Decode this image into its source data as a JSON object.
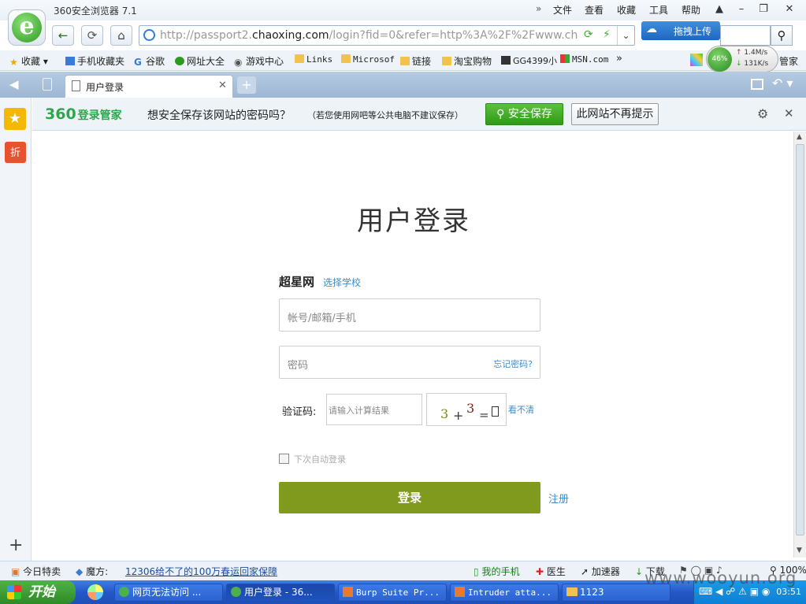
{
  "window": {
    "title": "360安全浏览器 7.1",
    "menu": [
      "文件",
      "查看",
      "收藏",
      "工具",
      "帮助"
    ]
  },
  "address": {
    "url_prefix": "http://passport2.",
    "url_domain": "chaoxing.com",
    "url_rest": "/login?fid=0&refer=http%3A%2F%2Fwww.chaoxir",
    "upload_label": "拖拽上传"
  },
  "bookmarks": [
    "收藏",
    "手机收藏夹",
    "谷歌",
    "网址大全",
    "游戏中心",
    "Links",
    "Microsof",
    "链接",
    "淘宝购物",
    "GG4399小",
    "MSN.com"
  ],
  "speed": {
    "percent": "46%",
    "up": "1.4M/s",
    "down": "131K/s",
    "label": "管家"
  },
  "tab": {
    "title": "用户登录"
  },
  "password_bar": {
    "logo_num": "360",
    "logo_text": "登录管家",
    "question": "想安全保存该网站的密码吗？",
    "note": "（若您使用网吧等公共电脑不建议保存）",
    "save_label": "安全保存",
    "never_label": "此网站不再提示"
  },
  "sidebar": {
    "discount_label": "折"
  },
  "login": {
    "page_title": "用户登录",
    "brand": "超星网",
    "choose_school": "选择学校",
    "account_placeholder": "帐号/邮箱/手机",
    "password_placeholder": "密码",
    "forgot": "忘记密码?",
    "captcha_label": "验证码:",
    "captcha_placeholder": "请输入计算结果",
    "captcha_a": "3",
    "captcha_op": "+",
    "captcha_b": "3",
    "captcha_eq": "=",
    "captcha_q": "?",
    "captcha_refresh": "看不清",
    "remember": "下次自动登录",
    "login_button": "登录",
    "register": "注册"
  },
  "statusbar": {
    "deals": "今日特卖",
    "magic": "魔方:",
    "news": "12306给不了的100万春运回家保障",
    "phone": "我的手机",
    "doctor": "医生",
    "accelerator": "加速器",
    "download": "下载",
    "zoom": "100%"
  },
  "taskbar": {
    "start": "开始",
    "tasks": [
      "网页无法访问 ...",
      "用户登录 - 36...",
      "Burp Suite Pr...",
      "Intruder atta...",
      "1123"
    ],
    "clock": "03:51"
  },
  "watermark": "www.wooyun.org",
  "colors": {
    "login_button": "#7f9a1d",
    "link": "#3b8ccc",
    "save_green": "#2f9a18"
  }
}
